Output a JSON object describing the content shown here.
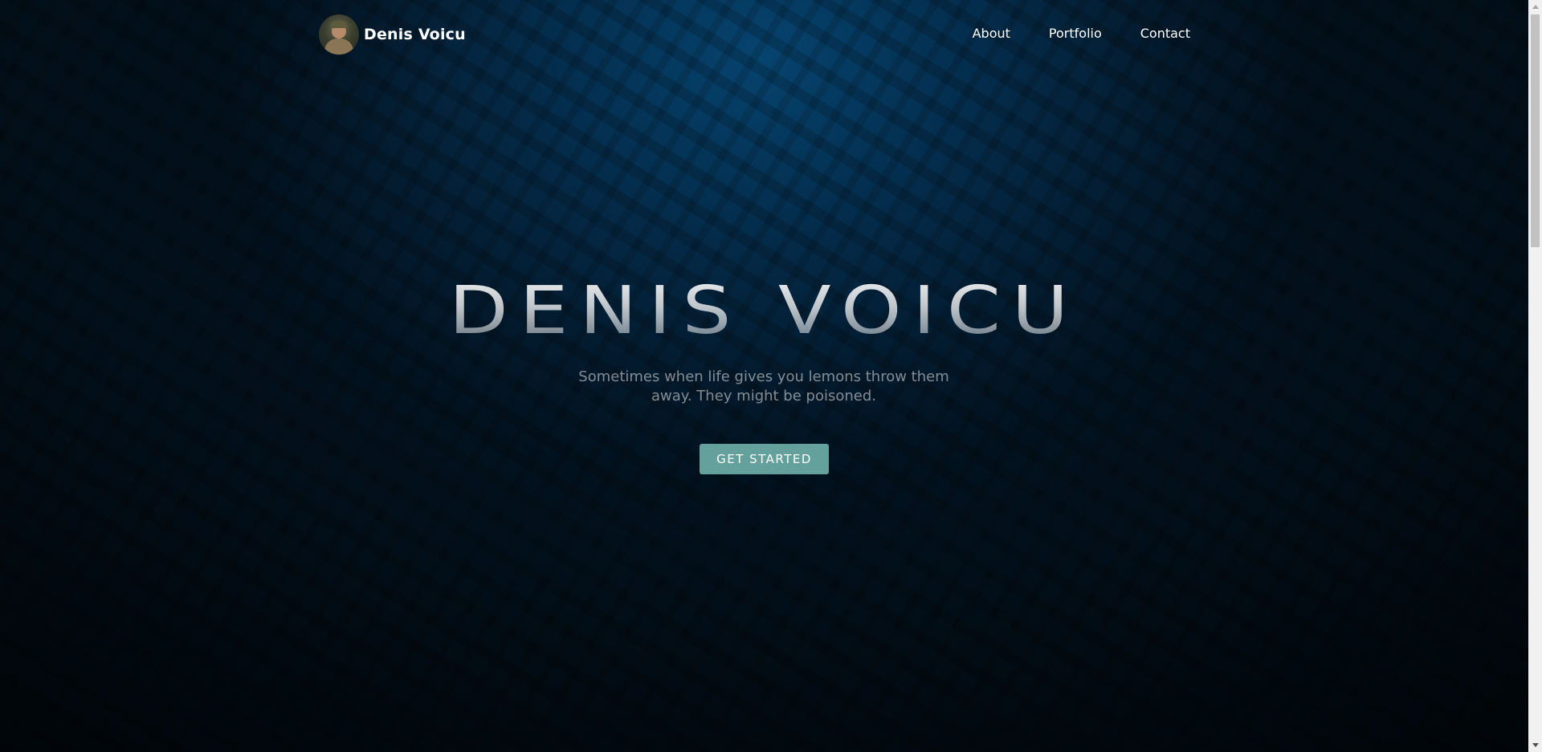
{
  "navbar": {
    "brand_name": "Denis Voicu",
    "links": [
      {
        "label": "About"
      },
      {
        "label": "Portfolio"
      },
      {
        "label": "Contact"
      }
    ]
  },
  "hero": {
    "title": "DENIS VOICU",
    "subtitle": "Sometimes when life gives you lemons throw them away. They might be poisoned.",
    "cta_label": "GET STARTED"
  },
  "colors": {
    "background": "#031a2c",
    "accent": "#64a19d",
    "text": "#ffffff"
  },
  "icons": {
    "avatar": "profile-photo",
    "scroll_up": "arrow-up-icon",
    "scroll_down": "arrow-down-icon"
  }
}
